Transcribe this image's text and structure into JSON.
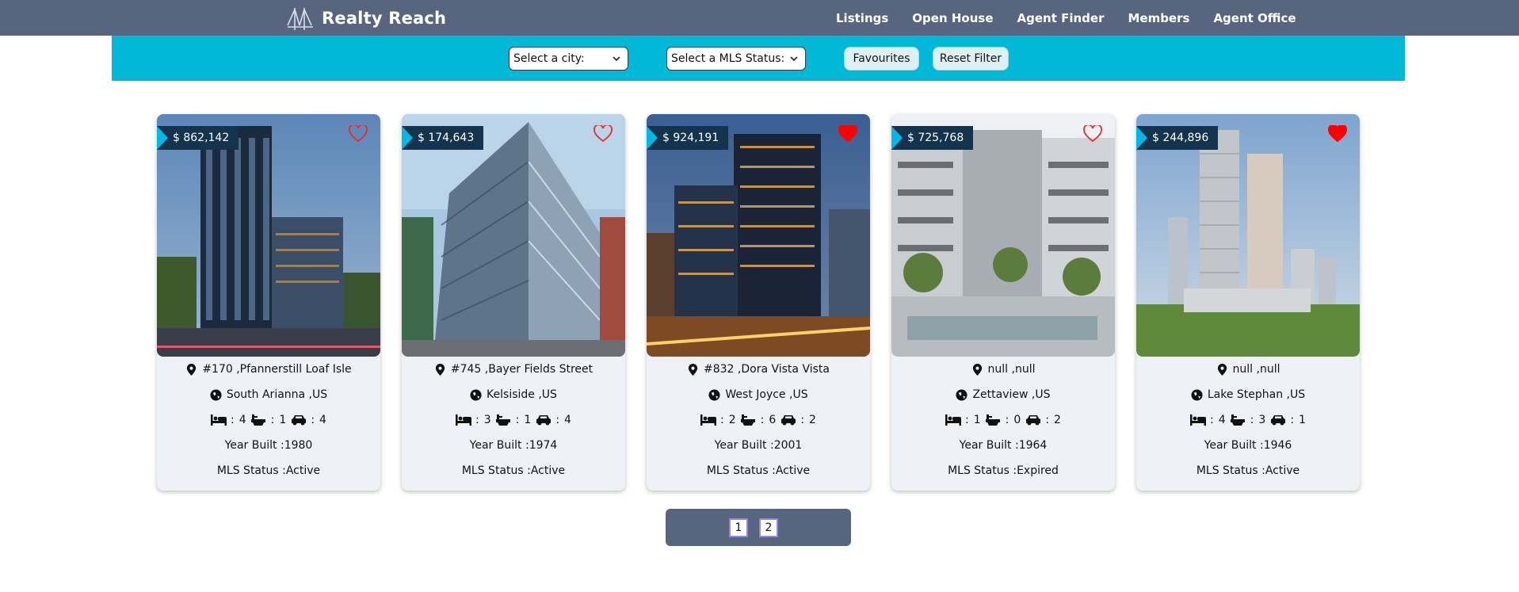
{
  "app": {
    "name": "Realty Reach"
  },
  "nav": {
    "items": [
      "Listings",
      "Open House",
      "Agent Finder",
      "Members",
      "Agent Office"
    ]
  },
  "filters": {
    "city_placeholder": "Select a city:",
    "status_placeholder": "Select a MLS Status:",
    "favourites_label": "Favourites",
    "reset_label": "Reset Filter"
  },
  "labels": {
    "year_built": "Year Built :",
    "mls_status": "MLS Status :"
  },
  "listings": [
    {
      "price": "$ 862,142",
      "favourite": false,
      "address": "#170 ,Pfannerstill Loaf Isle",
      "city": "South Arianna ,US",
      "beds": "4",
      "baths": "1",
      "parking": "4",
      "year": "1980",
      "status": "Active"
    },
    {
      "price": "$ 174,643",
      "favourite": false,
      "address": "#745 ,Bayer Fields Street",
      "city": "Kelsiside ,US",
      "beds": "3",
      "baths": "1",
      "parking": "4",
      "year": "1974",
      "status": "Active"
    },
    {
      "price": "$ 924,191",
      "favourite": true,
      "address": "#832 ,Dora Vista Vista",
      "city": "West Joyce ,US",
      "beds": "2",
      "baths": "6",
      "parking": "2",
      "year": "2001",
      "status": "Active"
    },
    {
      "price": "$ 725,768",
      "favourite": false,
      "address": "null ,null",
      "city": "Zettaview ,US",
      "beds": "1",
      "baths": "0",
      "parking": "2",
      "year": "1964",
      "status": "Expired"
    },
    {
      "price": "$ 244,896",
      "favourite": true,
      "address": "null ,null",
      "city": "Lake Stephan ,US",
      "beds": "4",
      "baths": "3",
      "parking": "1",
      "year": "1946",
      "status": "Active"
    }
  ],
  "pagination": {
    "pages": [
      "1",
      "2"
    ]
  },
  "colors": {
    "navbar": "#58657e",
    "filterbar": "#00b8d8",
    "price_tag": "#14344e",
    "heart_filled": "#ff0000",
    "heart_outline": "#e03030"
  }
}
